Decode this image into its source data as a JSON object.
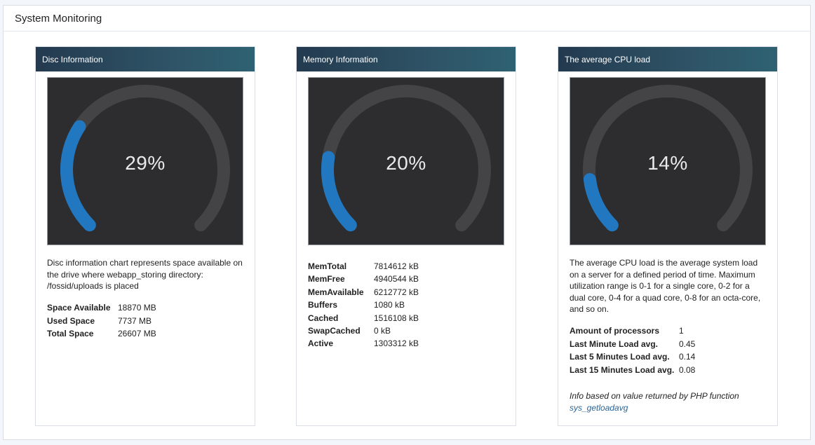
{
  "page": {
    "title": "System Monitoring"
  },
  "colors": {
    "accent": "#2178c0",
    "track": "#444446",
    "gauge_bg": "#2d2d2f"
  },
  "cards": [
    {
      "title": "Disc Information",
      "gauge": {
        "percent": 29,
        "label": "29%"
      },
      "description": "Disc information chart represents space available on the drive where webapp_storing directory: /fossid/uploads is placed",
      "rows": [
        {
          "label": "Space Available",
          "value": "18870 MB"
        },
        {
          "label": "Used Space",
          "value": "7737 MB"
        },
        {
          "label": "Total Space",
          "value": "26607 MB"
        }
      ]
    },
    {
      "title": "Memory Information",
      "gauge": {
        "percent": 20,
        "label": "20%"
      },
      "rows": [
        {
          "label": "MemTotal",
          "value": "7814612 kB"
        },
        {
          "label": "MemFree",
          "value": "4940544 kB"
        },
        {
          "label": "MemAvailable",
          "value": "6212772 kB"
        },
        {
          "label": "Buffers",
          "value": "1080 kB"
        },
        {
          "label": "Cached",
          "value": "1516108 kB"
        },
        {
          "label": "SwapCached",
          "value": "0 kB"
        },
        {
          "label": "Active",
          "value": "1303312 kB"
        }
      ]
    },
    {
      "title": "The average CPU load",
      "gauge": {
        "percent": 14,
        "label": "14%"
      },
      "description": "The average CPU load is the average system load on a server for a defined period of time. Maximum utilization range is 0-1 for a single core, 0-2 for a dual core, 0-4 for a quad core, 0-8 for an octa-core, and so on.",
      "rows": [
        {
          "label": "Amount of processors",
          "value": "1"
        },
        {
          "label": "Last Minute Load avg.",
          "value": "0.45"
        },
        {
          "label": "Last 5 Minutes Load avg.",
          "value": "0.14"
        },
        {
          "label": "Last 15 Minutes Load avg.",
          "value": "0.08"
        }
      ],
      "footnote": {
        "text": "Info based on value returned by PHP function",
        "link": "sys_getloadavg"
      }
    }
  ]
}
